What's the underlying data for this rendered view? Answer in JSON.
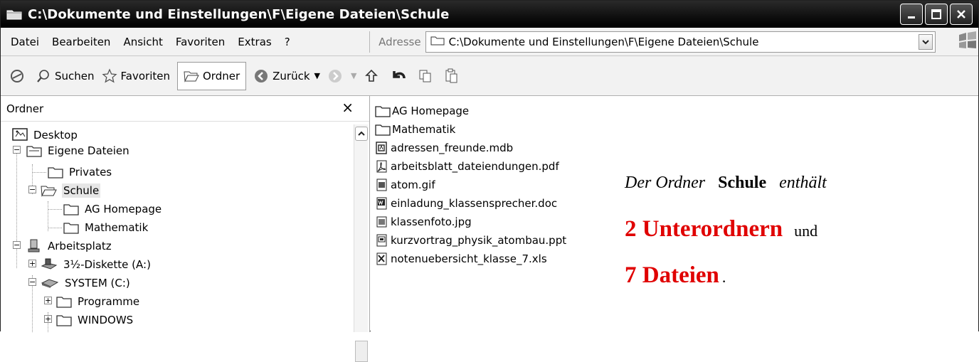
{
  "window": {
    "title": "C:\\Dokumente und Einstellungen\\F\\Eigene Dateien\\Schule"
  },
  "menubar": {
    "items": [
      "Datei",
      "Bearbeiten",
      "Ansicht",
      "Favoriten",
      "Extras",
      "?"
    ],
    "address_label": "Adresse",
    "address_value": "C:\\Dokumente und Einstellungen\\F\\Eigene Dateien\\Schule"
  },
  "toolbar": {
    "search_label": "Suchen",
    "favorites_label": "Favoriten",
    "folders_label": "Ordner",
    "back_label": "Zurück"
  },
  "folder_pane": {
    "title": "Ordner",
    "close_glyph": "×",
    "tree": [
      {
        "label": "Desktop",
        "icon": "desktop-icon"
      },
      {
        "label": "Eigene Dateien",
        "icon": "folder-icon"
      },
      {
        "label": "Privates",
        "icon": "folder-icon"
      },
      {
        "label": "Schule",
        "icon": "open-folder-icon",
        "selected": true
      },
      {
        "label": "AG Homepage",
        "icon": "folder-icon"
      },
      {
        "label": "Mathematik",
        "icon": "folder-icon"
      },
      {
        "label": "Arbeitsplatz",
        "icon": "computer-icon"
      },
      {
        "label": "3½-Diskette (A:)",
        "icon": "floppy-icon"
      },
      {
        "label": "SYSTEM (C:)",
        "icon": "drive-icon"
      },
      {
        "label": "Programme",
        "icon": "folder-icon"
      },
      {
        "label": "WINDOWS",
        "icon": "folder-icon"
      }
    ]
  },
  "files": [
    {
      "name": "AG Homepage",
      "icon": "folder-icon"
    },
    {
      "name": "Mathematik",
      "icon": "folder-icon"
    },
    {
      "name": "adressen_freunde.mdb",
      "icon": "access-file-icon"
    },
    {
      "name": "arbeitsblatt_dateiendungen.pdf",
      "icon": "pdf-file-icon"
    },
    {
      "name": "atom.gif",
      "icon": "image-file-icon"
    },
    {
      "name": "einladung_klassensprecher.doc",
      "icon": "word-file-icon"
    },
    {
      "name": "klassenfoto.jpg",
      "icon": "image-file-icon"
    },
    {
      "name": "kurzvortrag_physik_atombau.ppt",
      "icon": "powerpoint-file-icon"
    },
    {
      "name": "notenuebersicht_klasse_7.xls",
      "icon": "excel-file-icon"
    }
  ],
  "annotation": {
    "line1_a": "Der Ordner",
    "line1_b": "Schule",
    "line1_c": "enthält",
    "line2_big": "2  Unterordnern",
    "line2_small": "und",
    "line3_big": "7  Dateien",
    "line3_small": ".",
    "highlight_color": "#e00000"
  }
}
